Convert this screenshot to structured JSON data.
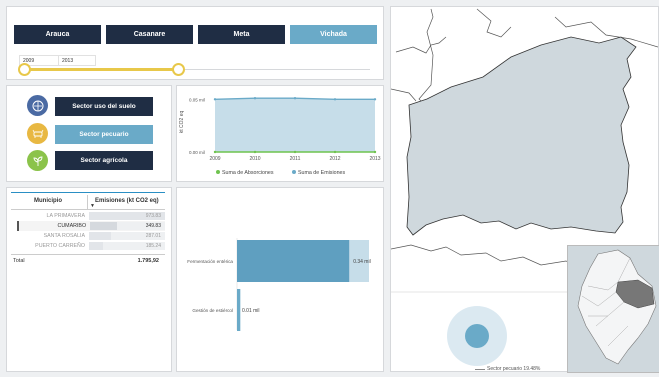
{
  "departments": [
    {
      "label": "Arauca",
      "active": false
    },
    {
      "label": "Casanare",
      "active": false
    },
    {
      "label": "Meta",
      "active": false
    },
    {
      "label": "Vichada",
      "active": true
    }
  ],
  "year_slider": {
    "start": "2009",
    "end": "2013",
    "range": [
      2009,
      2013
    ],
    "selected": [
      2009,
      2013
    ]
  },
  "sectors": [
    {
      "label": "Sector uso del suelo",
      "icon": "landuse-icon",
      "color": "#4a6aa3",
      "btn_color": "#1f2d44"
    },
    {
      "label": "Sector pecuario",
      "icon": "cattle-icon",
      "color": "#e8b842",
      "btn_color": "#6aaac8"
    },
    {
      "label": "Sector agrícola",
      "icon": "plant-icon",
      "color": "#8bc34a",
      "btn_color": "#1f2d44"
    }
  ],
  "table": {
    "col_municipio": "Municipio",
    "col_emisiones": "Emisiones (kt CO2 eq)",
    "rows": [
      {
        "municipio": "LA PRIMAVERA",
        "value": "973.83",
        "v": 973.83,
        "selected": false
      },
      {
        "municipio": "CUMARIBO",
        "value": "349.83",
        "v": 349.83,
        "selected": true
      },
      {
        "municipio": "SANTA ROSALIA",
        "value": "287.01",
        "v": 287.01,
        "selected": false
      },
      {
        "municipio": "PUERTO CARREÑO",
        "value": "185.24",
        "v": 185.24,
        "selected": false
      }
    ],
    "total_label": "Total",
    "total_value": "1.795,92"
  },
  "chart_data": [
    {
      "type": "area",
      "x": [
        2009,
        2010,
        2011,
        2012,
        2013
      ],
      "ylabel": "kt CO2 eq",
      "ytick_labels": [
        "0.05 mil",
        "0.00 mil"
      ],
      "yticks": [
        0.05,
        0.0
      ],
      "ylim": [
        0,
        0.055
      ],
      "series": [
        {
          "name": "Suma de Absorciones",
          "values": [
            0.0,
            0.0,
            0.0,
            0.0,
            0.0
          ],
          "color": "#6fc34f"
        },
        {
          "name": "Suma de Emisiones",
          "values": [
            0.05,
            0.051,
            0.051,
            0.05,
            0.05
          ],
          "color": "#6aaac8"
        }
      ],
      "legend": "bottom"
    },
    {
      "type": "bar",
      "orientation": "horizontal",
      "categories": [
        "Fermentación entérica",
        "Gestión de estiércol"
      ],
      "values": [
        0.34,
        0.01
      ],
      "value_labels": [
        "0.34 mil",
        "0.01 mil"
      ],
      "xlim": [
        0,
        0.4
      ]
    },
    {
      "type": "pie",
      "categories": [
        "Sector pecuario"
      ],
      "value_labels": [
        "Sector pecuario 19.48%"
      ],
      "values": [
        19.48
      ]
    }
  ],
  "colors": {
    "navy": "#1f2d44",
    "accent": "#6aaac8",
    "slider": "#e8c84a",
    "map_fill": "#cfd8dd"
  }
}
